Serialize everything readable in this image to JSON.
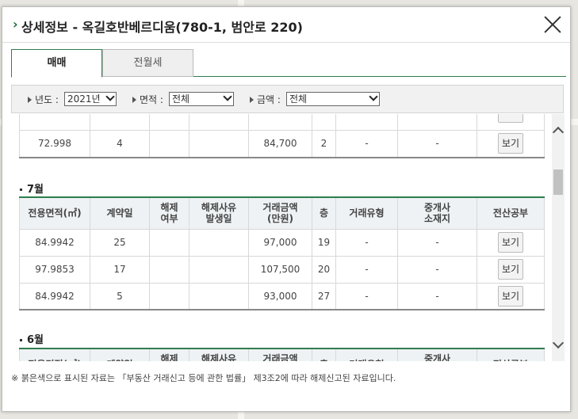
{
  "header": {
    "arrow": "›",
    "title": "상세정보 - 옥길호반베르디움(780-1, 범안로 220)"
  },
  "tabs": [
    {
      "label": "매매",
      "active": true
    },
    {
      "label": "전월세",
      "active": false
    }
  ],
  "filters": {
    "year": {
      "label": "년도 :",
      "value": "2021년"
    },
    "area": {
      "label": "면적 :",
      "value": "전체"
    },
    "amount": {
      "label": "금액 :",
      "value": "전체"
    }
  },
  "columns": [
    "전용면적(㎡)",
    "계약일",
    "해제\n여부",
    "해제사유\n발생일",
    "거래금액\n(만원)",
    "층",
    "거래유형",
    "중개사\n소재지",
    "전산공부"
  ],
  "partial_row": {
    "area": "72.998",
    "day": "4",
    "cancel": "",
    "cancel_date": "",
    "price": "84,700",
    "floor": "2",
    "type": "-",
    "agency": "-",
    "view": "보기"
  },
  "sections": [
    {
      "month": "7월",
      "rows": [
        {
          "area": "84.9942",
          "day": "25",
          "cancel": "",
          "cancel_date": "",
          "price": "97,000",
          "floor": "19",
          "type": "-",
          "agency": "-",
          "view": "보기"
        },
        {
          "area": "97.9853",
          "day": "17",
          "cancel": "",
          "cancel_date": "",
          "price": "107,500",
          "floor": "20",
          "type": "-",
          "agency": "-",
          "view": "보기"
        },
        {
          "area": "84.9942",
          "day": "5",
          "cancel": "",
          "cancel_date": "",
          "price": "93,000",
          "floor": "27",
          "type": "-",
          "agency": "-",
          "view": "보기"
        }
      ]
    },
    {
      "month": "6월",
      "rows": []
    }
  ],
  "note": "※ 붉은색으로 표시된 자료는 「부동산 거래신고 등에 관한 법률」 제3조2에 따라 해제신고된 자료입니다.",
  "colors": {
    "accent": "#2f7d4e",
    "header_bg": "#eef2f5"
  }
}
